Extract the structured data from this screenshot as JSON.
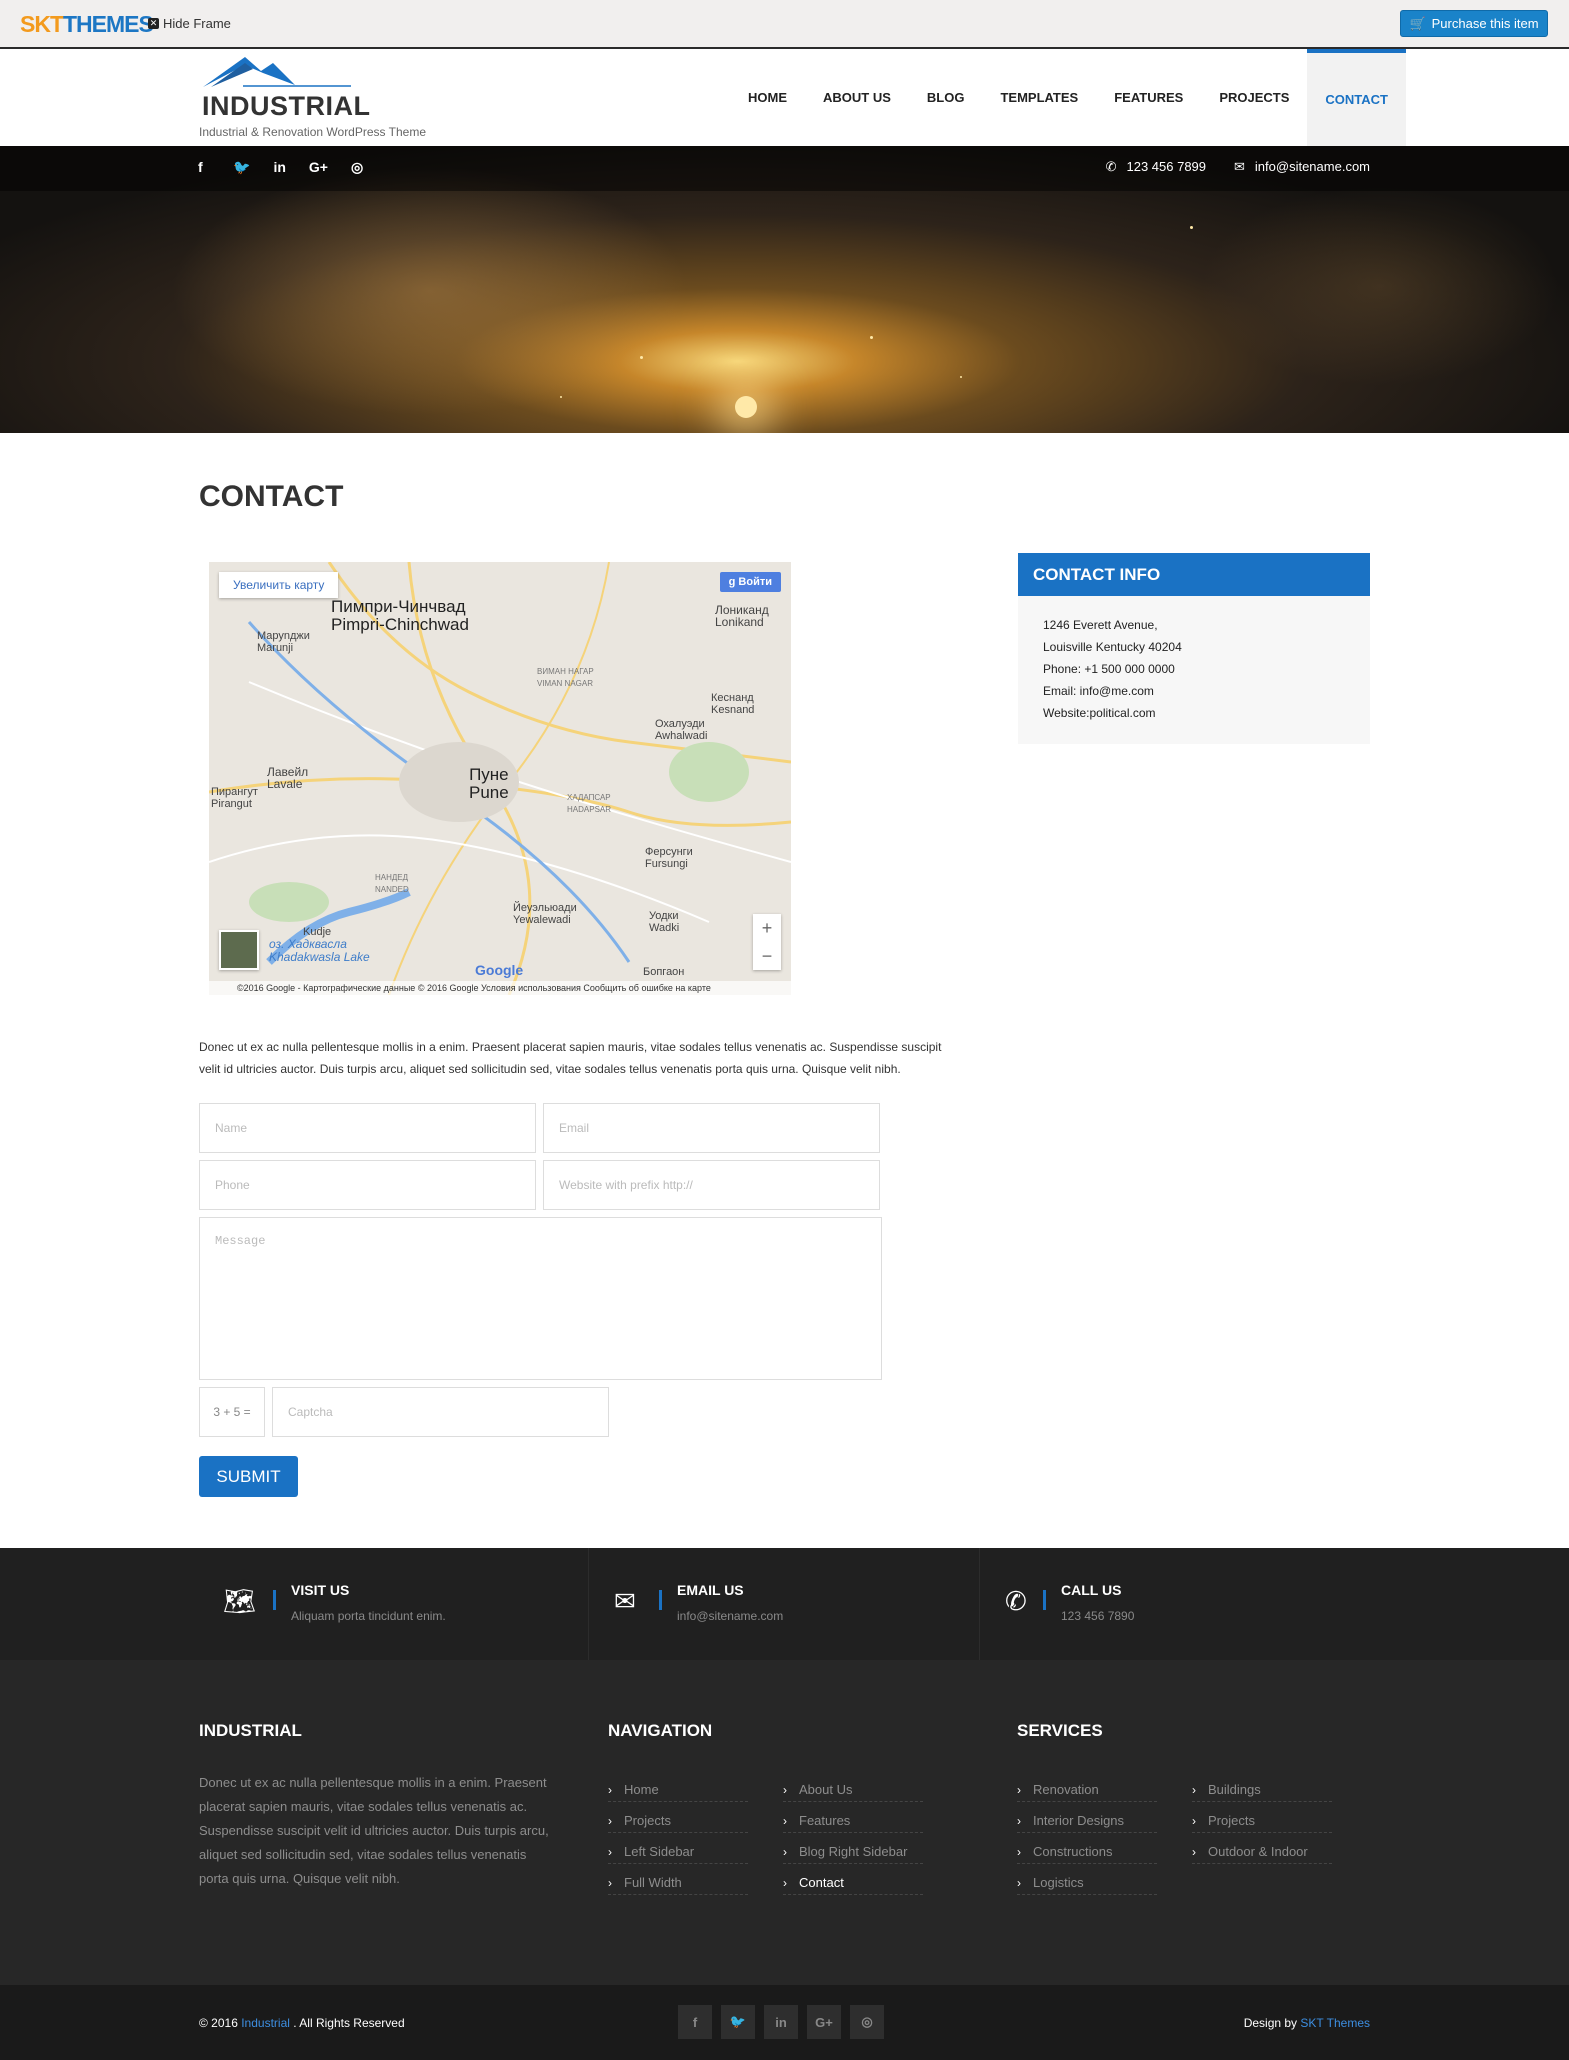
{
  "frame": {
    "brand_skt": "SKT",
    "brand_themes": "THEMES",
    "hide_frame": "Hide Frame",
    "purchase": "Purchase this item",
    "purchase_color": "#1a83c9"
  },
  "header": {
    "logo_name": "INDUSTRIAL",
    "logo_tagline": "Industrial & Renovation WordPress Theme",
    "nav": [
      "HOME",
      "ABOUT US",
      "BLOG",
      "TEMPLATES",
      "FEATURES",
      "PROJECTS",
      "CONTACT"
    ],
    "active_nav": "CONTACT",
    "accent_color": "#1a72c4"
  },
  "topbar": {
    "social_icons": [
      "facebook-icon",
      "twitter-icon",
      "linkedin-icon",
      "google-plus-icon",
      "instagram-icon"
    ],
    "social_glyphs": [
      "f",
      "🐦",
      "in",
      "G+",
      "◎"
    ],
    "phone": "123 456 7899",
    "email": "info@sitename.com"
  },
  "page": {
    "title": "CONTACT",
    "intro": "Donec ut ex ac nulla pellentesque mollis in a enim. Praesent placerat sapien mauris, vitae sodales tellus venenatis ac. Suspendisse suscipit velit id ultricies auctor. Duis turpis arcu, aliquet sed sollicitudin sed, vitae sodales tellus venenatis porta quis urna. Quisque velit nibh."
  },
  "map": {
    "enlarge": "Увеличить карту",
    "login": "Войти",
    "zoom_in": "+",
    "zoom_out": "−",
    "google": "Google",
    "attribution": "©2016 Google - Картографические данные © 2016 Google    Условия использования    Сообщить об ошибке на карте",
    "labels": {
      "pimpri_ru": "Пимпри-Чинчвад",
      "pimpri_en": "Pimpri-Chinchwad",
      "pune_ru": "Пуне",
      "pune_en": "Pune",
      "lonikand": "Лониканд",
      "lonikand_en": "Lonikand",
      "marunji": "Маруnджи",
      "marunji_en": "Marunji",
      "lavale": "Лавейл",
      "lavale_en": "Lavale",
      "kesnand": "Кеснанд",
      "kesnand_en": "Kesnand",
      "awhalwadi": "Охалуэди",
      "awhalwadi_en": "Awhalwadi",
      "fursungi": "Ферсунги",
      "fursungi_en": "Fursungi",
      "yewalewadi": "Йеуэльюади",
      "yewalewadi_en": "Yewalewadi",
      "wadki": "Уодки",
      "wadki_en": "Wadki",
      "pirangut": "Пирангут",
      "pirangut_en": "Pirangut",
      "kudje": "Kudje",
      "lake": "оз. Хадквасла",
      "lake_en": "Khadakwasla Lake",
      "viman": "ВИМАН НАГАР",
      "viman_en": "VIMAN NAGAR",
      "hadapsar": "ХАДАПСАР",
      "hadapsar_en": "HADAPSAR",
      "nanded": "НАНДЕД",
      "nanded_en": "NANDED",
      "bopgaon": "Бопгаон"
    }
  },
  "form": {
    "name_placeholder": "Name",
    "email_placeholder": "Email",
    "phone_placeholder": "Phone",
    "website_placeholder": "Website with prefix http://",
    "message_placeholder": "Message",
    "captcha_label": "3 + 5 =",
    "captcha_placeholder": "Captcha",
    "submit": "SUBMIT"
  },
  "contact_info": {
    "title": "CONTACT INFO",
    "address1": "1246 Everett Avenue,",
    "address2": "Louisville Kentucky 40204",
    "phone": "Phone: +1 500 000 0000",
    "email": "Email: info@me.com",
    "website": "Website:political.com"
  },
  "info_strip": [
    {
      "icon": "map-icon",
      "glyph": "🗺",
      "title": "VISIT US",
      "sub": "Aliquam porta tincidunt enim."
    },
    {
      "icon": "envelope-icon",
      "glyph": "✉",
      "title": "EMAIL US",
      "sub": "info@sitename.com"
    },
    {
      "icon": "phone-icon",
      "glyph": "✆",
      "title": "CALL US",
      "sub": "123 456 7890"
    }
  ],
  "footer": {
    "about_title": "INDUSTRIAL",
    "about_text": "Donec ut ex ac nulla pellentesque mollis in a enim. Praesent placerat sapien mauris, vitae sodales tellus venenatis ac. Suspendisse suscipit velit id ultricies auctor. Duis turpis arcu, aliquet sed sollicitudin sed, vitae sodales tellus venenatis porta quis urna. Quisque velit nibh.",
    "nav_title": "NAVIGATION",
    "nav_col1": [
      "Home",
      "Projects",
      "Left Sidebar",
      "Full Width"
    ],
    "nav_col2": [
      "About Us",
      "Features",
      "Blog Right Sidebar",
      "Contact"
    ],
    "services_title": "SERVICES",
    "services_col1": [
      "Renovation",
      "Interior Designs",
      "Constructions",
      "Logistics"
    ],
    "services_col2": [
      "Buildings",
      "Projects",
      "Outdoor & Indoor"
    ]
  },
  "copyright": {
    "prefix": "© 2016",
    "link": "Industrial",
    "suffix": ". All Rights Reserved",
    "design_prefix": "Design by",
    "design_link": "SKT Themes",
    "social_glyphs": [
      "f",
      "🐦",
      "in",
      "G+",
      "◎"
    ]
  }
}
